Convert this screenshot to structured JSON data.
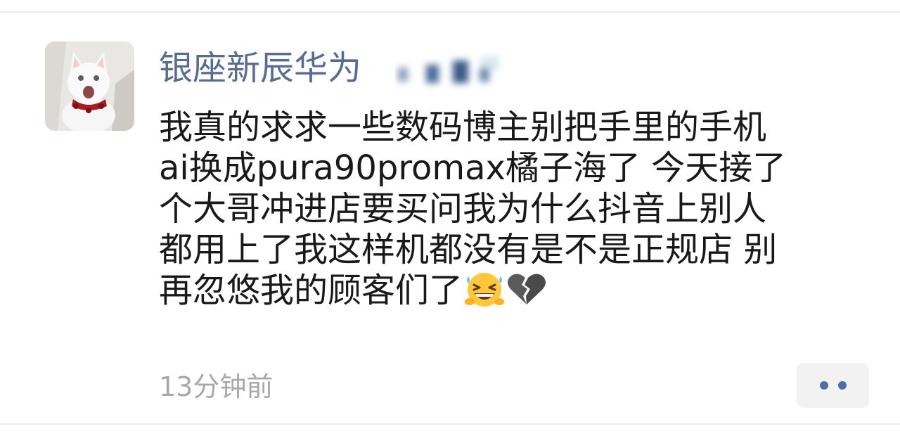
{
  "post": {
    "author": "银座新辰华为",
    "content_lines": [
      "我真的求求一些数码博主别把手里的手机",
      "ai换成pura90promax橘子海了 今天接了",
      "个大哥冲进店要买问我为什么抖音上别人",
      "都用上了我这样机都没有是不是正规店 别",
      "再忽悠我的顾客们了"
    ],
    "emojis": [
      "grinning-squinting-sweat-emoji",
      "broken-heart-emoji"
    ],
    "timestamp": "13分钟前"
  },
  "colors": {
    "author_link": "#576b95",
    "body_text": "#191919",
    "timestamp": "#a8a8a8",
    "more_dots": "#4e6ea5",
    "more_bg": "#f2f2f2"
  }
}
